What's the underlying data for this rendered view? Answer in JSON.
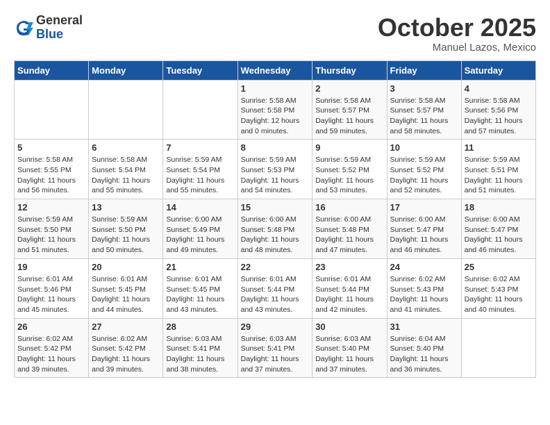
{
  "header": {
    "logo_line1": "General",
    "logo_line2": "Blue",
    "month": "October 2025",
    "location": "Manuel Lazos, Mexico"
  },
  "weekdays": [
    "Sunday",
    "Monday",
    "Tuesday",
    "Wednesday",
    "Thursday",
    "Friday",
    "Saturday"
  ],
  "weeks": [
    [
      {
        "day": "",
        "info": ""
      },
      {
        "day": "",
        "info": ""
      },
      {
        "day": "",
        "info": ""
      },
      {
        "day": "1",
        "info": "Sunrise: 5:58 AM\nSunset: 5:58 PM\nDaylight: 12 hours\nand 0 minutes."
      },
      {
        "day": "2",
        "info": "Sunrise: 5:58 AM\nSunset: 5:57 PM\nDaylight: 11 hours\nand 59 minutes."
      },
      {
        "day": "3",
        "info": "Sunrise: 5:58 AM\nSunset: 5:57 PM\nDaylight: 11 hours\nand 58 minutes."
      },
      {
        "day": "4",
        "info": "Sunrise: 5:58 AM\nSunset: 5:56 PM\nDaylight: 11 hours\nand 57 minutes."
      }
    ],
    [
      {
        "day": "5",
        "info": "Sunrise: 5:58 AM\nSunset: 5:55 PM\nDaylight: 11 hours\nand 56 minutes."
      },
      {
        "day": "6",
        "info": "Sunrise: 5:58 AM\nSunset: 5:54 PM\nDaylight: 11 hours\nand 55 minutes."
      },
      {
        "day": "7",
        "info": "Sunrise: 5:59 AM\nSunset: 5:54 PM\nDaylight: 11 hours\nand 55 minutes."
      },
      {
        "day": "8",
        "info": "Sunrise: 5:59 AM\nSunset: 5:53 PM\nDaylight: 11 hours\nand 54 minutes."
      },
      {
        "day": "9",
        "info": "Sunrise: 5:59 AM\nSunset: 5:52 PM\nDaylight: 11 hours\nand 53 minutes."
      },
      {
        "day": "10",
        "info": "Sunrise: 5:59 AM\nSunset: 5:52 PM\nDaylight: 11 hours\nand 52 minutes."
      },
      {
        "day": "11",
        "info": "Sunrise: 5:59 AM\nSunset: 5:51 PM\nDaylight: 11 hours\nand 51 minutes."
      }
    ],
    [
      {
        "day": "12",
        "info": "Sunrise: 5:59 AM\nSunset: 5:50 PM\nDaylight: 11 hours\nand 51 minutes."
      },
      {
        "day": "13",
        "info": "Sunrise: 5:59 AM\nSunset: 5:50 PM\nDaylight: 11 hours\nand 50 minutes."
      },
      {
        "day": "14",
        "info": "Sunrise: 6:00 AM\nSunset: 5:49 PM\nDaylight: 11 hours\nand 49 minutes."
      },
      {
        "day": "15",
        "info": "Sunrise: 6:00 AM\nSunset: 5:48 PM\nDaylight: 11 hours\nand 48 minutes."
      },
      {
        "day": "16",
        "info": "Sunrise: 6:00 AM\nSunset: 5:48 PM\nDaylight: 11 hours\nand 47 minutes."
      },
      {
        "day": "17",
        "info": "Sunrise: 6:00 AM\nSunset: 5:47 PM\nDaylight: 11 hours\nand 46 minutes."
      },
      {
        "day": "18",
        "info": "Sunrise: 6:00 AM\nSunset: 5:47 PM\nDaylight: 11 hours\nand 46 minutes."
      }
    ],
    [
      {
        "day": "19",
        "info": "Sunrise: 6:01 AM\nSunset: 5:46 PM\nDaylight: 11 hours\nand 45 minutes."
      },
      {
        "day": "20",
        "info": "Sunrise: 6:01 AM\nSunset: 5:45 PM\nDaylight: 11 hours\nand 44 minutes."
      },
      {
        "day": "21",
        "info": "Sunrise: 6:01 AM\nSunset: 5:45 PM\nDaylight: 11 hours\nand 43 minutes."
      },
      {
        "day": "22",
        "info": "Sunrise: 6:01 AM\nSunset: 5:44 PM\nDaylight: 11 hours\nand 43 minutes."
      },
      {
        "day": "23",
        "info": "Sunrise: 6:01 AM\nSunset: 5:44 PM\nDaylight: 11 hours\nand 42 minutes."
      },
      {
        "day": "24",
        "info": "Sunrise: 6:02 AM\nSunset: 5:43 PM\nDaylight: 11 hours\nand 41 minutes."
      },
      {
        "day": "25",
        "info": "Sunrise: 6:02 AM\nSunset: 5:43 PM\nDaylight: 11 hours\nand 40 minutes."
      }
    ],
    [
      {
        "day": "26",
        "info": "Sunrise: 6:02 AM\nSunset: 5:42 PM\nDaylight: 11 hours\nand 39 minutes."
      },
      {
        "day": "27",
        "info": "Sunrise: 6:02 AM\nSunset: 5:42 PM\nDaylight: 11 hours\nand 39 minutes."
      },
      {
        "day": "28",
        "info": "Sunrise: 6:03 AM\nSunset: 5:41 PM\nDaylight: 11 hours\nand 38 minutes."
      },
      {
        "day": "29",
        "info": "Sunrise: 6:03 AM\nSunset: 5:41 PM\nDaylight: 11 hours\nand 37 minutes."
      },
      {
        "day": "30",
        "info": "Sunrise: 6:03 AM\nSunset: 5:40 PM\nDaylight: 11 hours\nand 37 minutes."
      },
      {
        "day": "31",
        "info": "Sunrise: 6:04 AM\nSunset: 5:40 PM\nDaylight: 11 hours\nand 36 minutes."
      },
      {
        "day": "",
        "info": ""
      }
    ]
  ]
}
